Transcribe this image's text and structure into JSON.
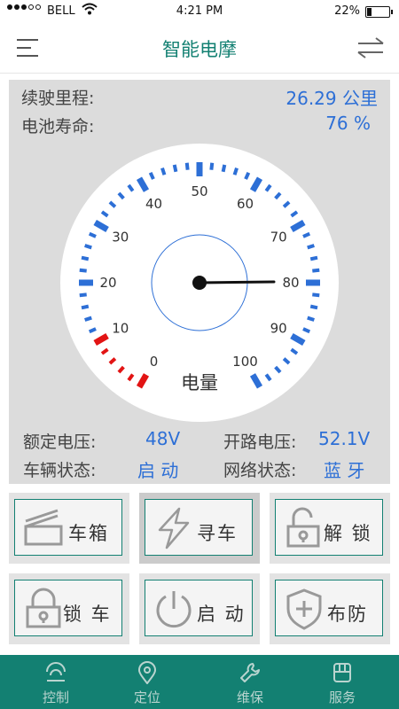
{
  "status_bar": {
    "carrier": "BELL",
    "time": "4:21 PM",
    "battery": "22%",
    "battery_level": 0.22
  },
  "header": {
    "title": "智能电摩"
  },
  "info": {
    "range_label": "续驶里程:",
    "range_value": "26.29 公里",
    "battery_label": "电池寿命:",
    "battery_value": "76 %"
  },
  "gauge": {
    "labels": [
      "0",
      "10",
      "20",
      "30",
      "40",
      "50",
      "60",
      "70",
      "80",
      "90",
      "100"
    ],
    "center_label": "电量",
    "needle_value": 80,
    "min": 0,
    "max": 100,
    "tick_color": "#2d6fd6",
    "low_color": "#e21414"
  },
  "specs": {
    "rated_voltage_label": "额定电压:",
    "rated_voltage_value": "48V",
    "open_voltage_label": "开路电压:",
    "open_voltage_value": "52.1V",
    "vehicle_state_label": "车辆状态:",
    "vehicle_state_value": "启 动",
    "network_state_label": "网络状态:",
    "network_state_value": "蓝 牙"
  },
  "actions": [
    {
      "label": "车箱",
      "icon": "trunk-icon"
    },
    {
      "label": "寻车",
      "icon": "lightning-icon"
    },
    {
      "label": "解 锁",
      "icon": "unlock-icon"
    },
    {
      "label": "锁 车",
      "icon": "lock-icon"
    },
    {
      "label": "启 动",
      "icon": "power-icon"
    },
    {
      "label": "布防",
      "icon": "shield-plus-icon"
    }
  ],
  "tabs": [
    {
      "label": "控制",
      "icon": "control-icon"
    },
    {
      "label": "定位",
      "icon": "location-pin-icon"
    },
    {
      "label": "维保",
      "icon": "wrench-icon"
    },
    {
      "label": "服务",
      "icon": "service-icon"
    }
  ],
  "colors": {
    "brand": "#138072",
    "accent": "#2d6fd6",
    "warning": "#e21414"
  }
}
